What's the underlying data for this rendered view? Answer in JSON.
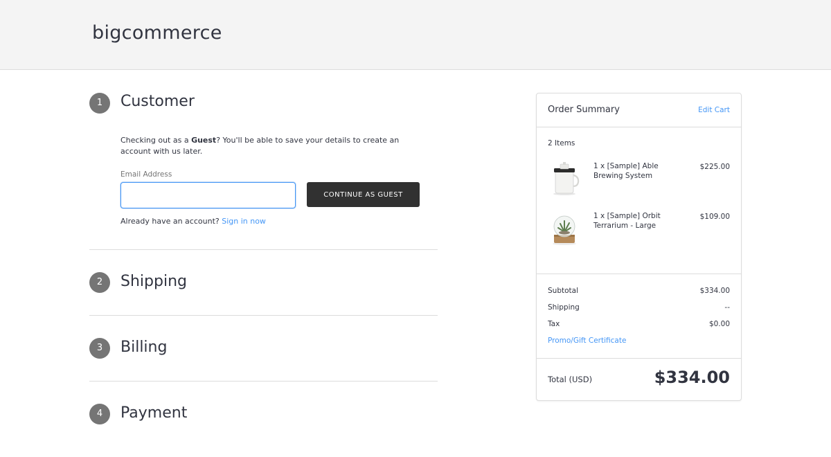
{
  "header": {
    "logo": "bigcommerce"
  },
  "steps": [
    {
      "number": "1",
      "title": "Customer"
    },
    {
      "number": "2",
      "title": "Shipping"
    },
    {
      "number": "3",
      "title": "Billing"
    },
    {
      "number": "4",
      "title": "Payment"
    }
  ],
  "customer": {
    "guest_prefix": "Checking out as a ",
    "guest_bold": "Guest",
    "guest_suffix": "? You'll be able to save your details to create an account with us later.",
    "email_label": "Email Address",
    "email_value": "",
    "continue_button": "CONTINUE AS GUEST",
    "have_account": "Already have an account?",
    "sign_in": "Sign in now"
  },
  "summary": {
    "title": "Order Summary",
    "edit_cart": "Edit Cart",
    "items_count": "2 Items",
    "items": [
      {
        "name": "1 x [Sample] Able Brewing System",
        "price": "$225.00",
        "icon": "brewing-system-image"
      },
      {
        "name": "1 x [Sample] Orbit Terrarium - Large",
        "price": "$109.00",
        "icon": "terrarium-image"
      }
    ],
    "subtotal_label": "Subtotal",
    "subtotal_value": "$334.00",
    "shipping_label": "Shipping",
    "shipping_value": "--",
    "tax_label": "Tax",
    "tax_value": "$0.00",
    "promo": "Promo/Gift Certificate",
    "total_label": "Total (USD)",
    "total_value": "$334.00"
  },
  "colors": {
    "accent": "#4496f6",
    "button": "#313131",
    "step_circle": "#757575"
  }
}
